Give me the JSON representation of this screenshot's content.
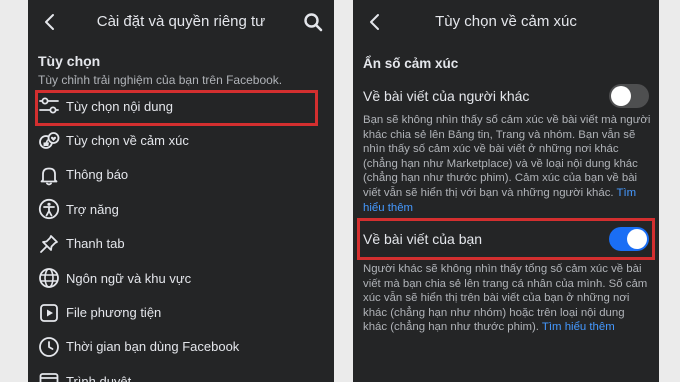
{
  "left": {
    "title": "Cài đặt và quyền riêng tư",
    "section_heading": "Tùy chọn",
    "section_desc": "Tùy chỉnh trải nghiệm của bạn trên Facebook.",
    "menu": [
      {
        "label": "Tùy chọn nội dung",
        "icon": "sliders-icon"
      },
      {
        "label": "Tùy chọn về cảm xúc",
        "icon": "reactions-icon"
      },
      {
        "label": "Thông báo",
        "icon": "bell-icon"
      },
      {
        "label": "Trợ năng",
        "icon": "accessibility-icon"
      },
      {
        "label": "Thanh tab",
        "icon": "pin-icon"
      },
      {
        "label": "Ngôn ngữ và khu vực",
        "icon": "globe-icon"
      },
      {
        "label": "File phương tiện",
        "icon": "media-icon"
      },
      {
        "label": "Thời gian bạn dùng Facebook",
        "icon": "clock-icon"
      },
      {
        "label": "Trình duyệt",
        "icon": "browser-icon"
      }
    ]
  },
  "right": {
    "title": "Tùy chọn về cảm xúc",
    "heading": "Ẩn số cảm xúc",
    "others": {
      "label": "Về bài viết của người khác",
      "toggle_on": false,
      "desc": "Bạn sẽ không nhìn thấy số cảm xúc về bài viết mà người khác chia sẻ lên Bảng tin, Trang và nhóm. Bạn vẫn sẽ nhìn thấy số cảm xúc về bài viết ở những nơi khác (chẳng hạn như Marketplace) và về loại nội dung khác (chẳng hạn như thước phim). Cảm xúc của bạn về bài viết vẫn sẽ hiển thị với bạn và những người khác.",
      "link": "Tìm hiểu thêm"
    },
    "yours": {
      "label": "Về bài viết của bạn",
      "toggle_on": true,
      "desc": "Người khác sẽ không nhìn thấy tổng số cảm xúc về bài viết mà bạn chia sẻ lên trang cá nhân của mình. Số cảm xúc vẫn sẽ hiển thị trên bài viết của bạn ở những nơi khác (chẳng hạn như nhóm) hoặc trên loại nội dung khác (chẳng hạn như thước phim).",
      "link": "Tìm hiểu thêm"
    }
  },
  "colors": {
    "background": "#242526",
    "highlight": "#d32f2f",
    "toggle_on": "#1a6ef5",
    "link": "#4599ff"
  }
}
